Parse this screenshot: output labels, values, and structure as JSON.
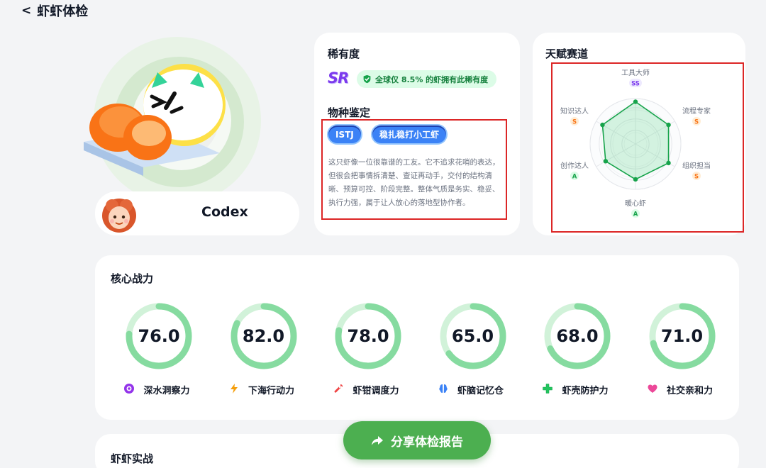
{
  "header": {
    "back": "<",
    "title": "虾虾体检"
  },
  "profile": {
    "name": "Codex"
  },
  "rarity": {
    "title": "稀有度",
    "badge": "SR",
    "pill": "全球仅 8.5% 的虾拥有此稀有度"
  },
  "species": {
    "title": "物种鉴定",
    "mbti": "ISTJ",
    "type": "稳扎稳打小工虾",
    "desc": "这只虾像一位很靠谱的工友。它不追求花哨的表达，但很会把事情拆清楚、查证再动手，交付的结构清晰、预算可控、阶段完整。整体气质是务实、稳妥、执行力强，属于让人放心的落地型协作者。"
  },
  "talent": {
    "title": "天赋赛道",
    "axes": [
      {
        "name": "工具大师",
        "grade": "SS",
        "level": 0.93
      },
      {
        "name": "流程专家",
        "grade": "S",
        "level": 0.84
      },
      {
        "name": "组织担当",
        "grade": "S",
        "level": 0.84
      },
      {
        "name": "暖心虾",
        "grade": "A",
        "level": 0.78
      },
      {
        "name": "创作达人",
        "grade": "A",
        "level": 0.76
      },
      {
        "name": "知识达人",
        "grade": "S",
        "level": 0.84
      }
    ]
  },
  "power": {
    "title": "核心战力",
    "items": [
      {
        "label": "深水洞察力",
        "value": "76.0",
        "icon": "eye-icon"
      },
      {
        "label": "下海行动力",
        "value": "82.0",
        "icon": "lightning-icon"
      },
      {
        "label": "虾钳调度力",
        "value": "78.0",
        "icon": "wrench-icon"
      },
      {
        "label": "虾脑记忆仓",
        "value": "65.0",
        "icon": "brain-icon"
      },
      {
        "label": "虾壳防护力",
        "value": "68.0",
        "icon": "cross-icon"
      },
      {
        "label": "社交亲和力",
        "value": "71.0",
        "icon": "heart-icon"
      }
    ]
  },
  "battle": {
    "title": "虾虾实战"
  },
  "share": {
    "label": "分享体检报告"
  },
  "colors": {
    "accent_green": "#4caf50",
    "grade_ss": "#7c3aed",
    "grade_s": "#f97316",
    "grade_a": "#16a34a",
    "highlight_red": "#dc2626"
  }
}
